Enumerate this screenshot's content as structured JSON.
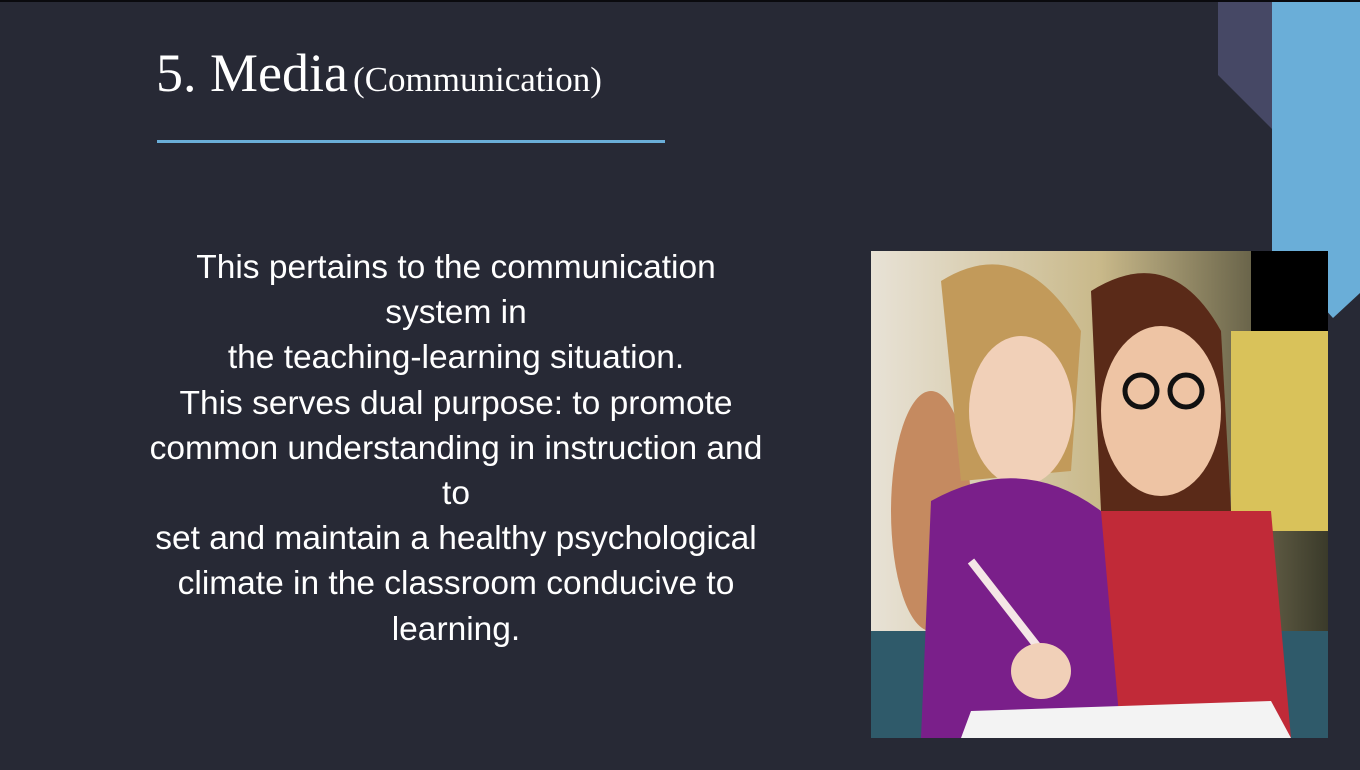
{
  "slide": {
    "title_main": "5. Media",
    "title_sub": "(Communication)",
    "body_lines": [
      "This pertains to the communication",
      "system in",
      "the teaching-learning situation.",
      "This serves dual purpose: to promote",
      "common understanding in instruction and",
      "to",
      "set and maintain a healthy psychological",
      "climate in the classroom conducive to",
      "learning."
    ],
    "colors": {
      "background": "#272935",
      "accent": "#6aaed8",
      "accent_dark": "#464865"
    }
  }
}
